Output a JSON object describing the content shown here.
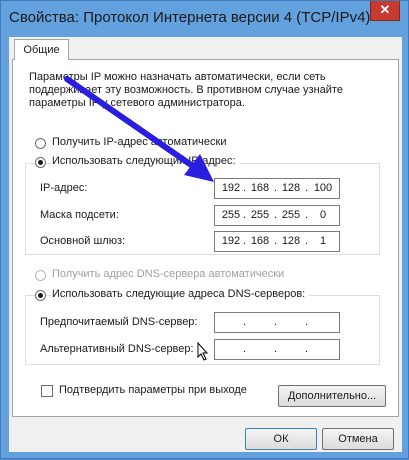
{
  "window": {
    "title": "Свойства: Протокол Интернета версии 4 (TCP/IPv4)",
    "close_glyph": "✕"
  },
  "tabs": [
    {
      "label": "Общие"
    }
  ],
  "description": "Параметры IP можно назначать автоматически, если сеть\nподдерживает эту возможность. В противном случае узнайте\nпараметры IP у сетевого администратора.",
  "ip_mode": {
    "auto_label": "Получить IP-адрес автоматически",
    "manual_label": "Использовать следующий IP-адрес:",
    "selected": "manual"
  },
  "ip_fields": {
    "ip": {
      "label": "IP-адрес:",
      "octets": [
        "192",
        "168",
        "128",
        "100"
      ]
    },
    "mask": {
      "label": "Маска подсети:",
      "octets": [
        "255",
        "255",
        "255",
        "0"
      ]
    },
    "gateway": {
      "label": "Основной шлюз:",
      "octets": [
        "192",
        "168",
        "128",
        "1"
      ]
    }
  },
  "dns_mode": {
    "auto_label": "Получить адрес DNS-сервера автоматически",
    "manual_label": "Использовать следующие адреса DNS-серверов:",
    "selected": "manual"
  },
  "dns_fields": {
    "preferred": {
      "label": "Предпочитаемый DNS-сервер:",
      "octets": [
        "",
        "",
        "",
        ""
      ]
    },
    "alternate": {
      "label": "Альтернативный DNS-сервер:",
      "octets": [
        "",
        "",
        "",
        ""
      ]
    }
  },
  "validate": {
    "label": "Подтвердить параметры при выходе",
    "checked": false
  },
  "buttons": {
    "advanced": "Дополнительно...",
    "ok": "ОК",
    "cancel": "Отмена"
  },
  "colors": {
    "arrow": "#2a1ee0",
    "titlebar": "#62a0de",
    "close": "#c73a30"
  },
  "icons": {
    "close": "close-icon",
    "arrow": "annotation-arrow",
    "cursor": "mouse-cursor-icon"
  }
}
